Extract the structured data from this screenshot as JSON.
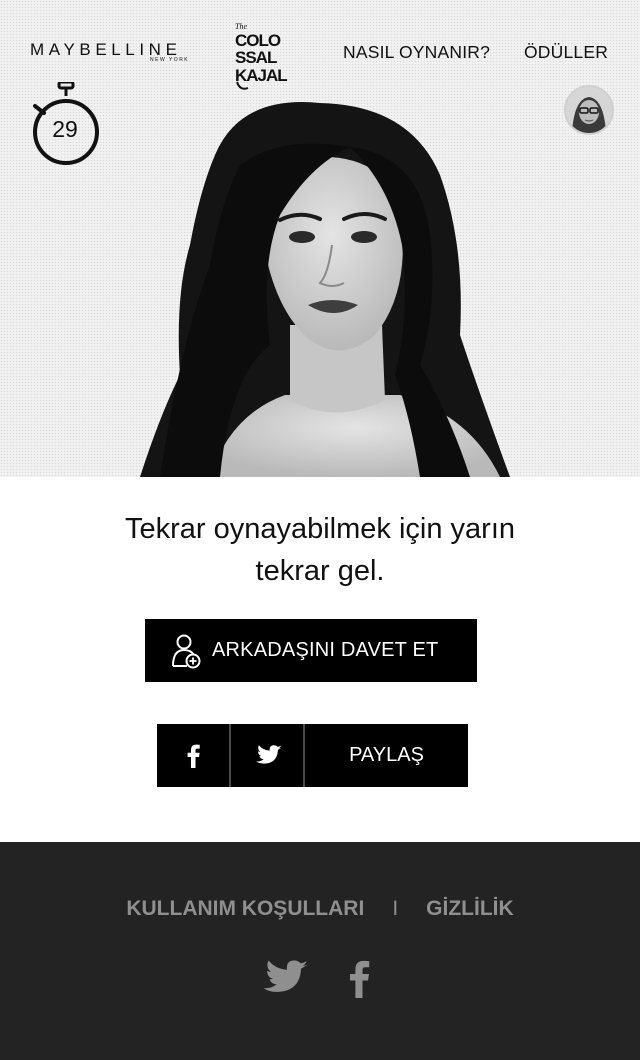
{
  "header": {
    "brand_name": "MAYBELLINE",
    "brand_subtitle": "NEW YORK",
    "campaign_logo": "The COLOSSAL KAJAL",
    "nav": [
      {
        "label": "NASIL OYNANIR?"
      },
      {
        "label": "ÖDÜLLER"
      }
    ]
  },
  "timer": {
    "value": "29",
    "icon": "stopwatch-icon"
  },
  "message": {
    "line1": "Tekrar oynayabilmek için yarın",
    "line2": "tekrar gel."
  },
  "invite_button": {
    "label": "ARKADAŞINI DAVET ET",
    "icon": "add-user-icon"
  },
  "share": {
    "label": "PAYLAŞ",
    "icons": [
      "facebook-icon",
      "twitter-icon"
    ]
  },
  "footer": {
    "links": [
      "KULLANIM KOŞULLARI",
      "GİZLİLİK"
    ],
    "separator": "I",
    "social_icons": [
      "twitter-icon",
      "facebook-icon"
    ]
  },
  "colors": {
    "primary_button": "#000000",
    "footer_bg": "#232323",
    "footer_text": "#8f8f8f",
    "hero_bg": "#f2f2f2"
  }
}
